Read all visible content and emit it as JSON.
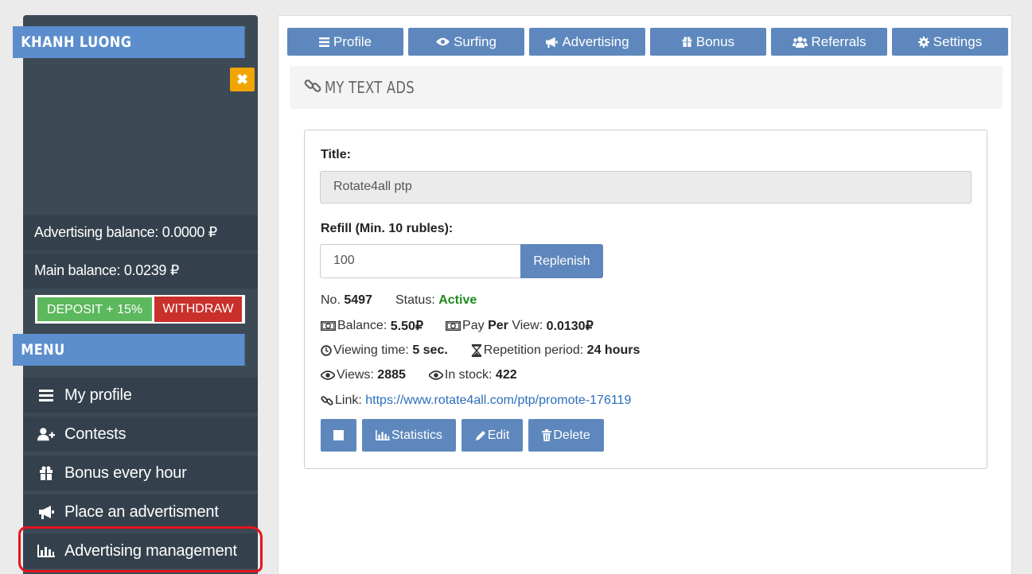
{
  "sidebar": {
    "username": "KHANH LUONG",
    "close_icon": "close-icon",
    "advertising_balance": "Advertising balance: 0.0000 ₽",
    "main_balance": "Main balance: 0.0239 ₽",
    "deposit_label": "DEPOSIT + 15%",
    "withdraw_label": "WITHDRAW",
    "menu_title": "MENU",
    "menu_items": [
      {
        "label": "My profile",
        "icon": "list-icon"
      },
      {
        "label": "Contests",
        "icon": "user-plus-icon"
      },
      {
        "label": "Bonus every hour",
        "icon": "gift-icon"
      },
      {
        "label": "Place an advertisment",
        "icon": "megaphone-icon"
      },
      {
        "label": "Advertising management",
        "icon": "bar-chart-icon"
      }
    ]
  },
  "tabs": [
    {
      "label": "Profile",
      "icon": "list-icon"
    },
    {
      "label": "Surfing",
      "icon": "eye-icon"
    },
    {
      "label": "Advertising",
      "icon": "megaphone-icon"
    },
    {
      "label": "Bonus",
      "icon": "gift-icon"
    },
    {
      "label": "Referrals",
      "icon": "users-icon"
    },
    {
      "label": "Settings",
      "icon": "gear-icon"
    }
  ],
  "section": {
    "title": "MY TEXT ADS",
    "icon": "link-icon"
  },
  "ad": {
    "title_label": "Title:",
    "title_value": "Rotate4all ptp",
    "refill_label": "Refill (Min. 10 rubles):",
    "refill_value": "100",
    "replenish_label": "Replenish",
    "no_label": "No.",
    "no_value": "5497",
    "status_label": "Status:",
    "status_value": "Active",
    "balance_label": "Balance:",
    "balance_value": "5.50₽",
    "pay_label": "Pay",
    "pay_per": "Per",
    "pay_view_label": "View:",
    "pay_value": "0.0130₽",
    "viewing_label": "Viewing time:",
    "viewing_value": "5 sec.",
    "repetition_label": "Repetition period:",
    "repetition_value": "24 hours",
    "views_label": "Views:",
    "views_value": "2885",
    "stock_label": "In stock:",
    "stock_value": "422",
    "link_label": "Link:",
    "link_value": "https://www.rotate4all.com/ptp/promote-176119",
    "buttons": {
      "statistics": "Statistics",
      "edit": "Edit",
      "delete": "Delete"
    }
  },
  "colors": {
    "accent": "#5e88bd",
    "sidebar": "#3c4a56",
    "active": "#1e8a1e",
    "deposit": "#5cb85c",
    "withdraw": "#c9302c",
    "highlight": "#e8141c"
  }
}
